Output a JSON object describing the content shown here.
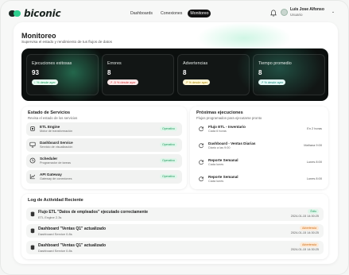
{
  "brand": {
    "name": "biconic"
  },
  "nav": {
    "items": [
      "Dashboards",
      "Conexiones",
      "Monitoreo"
    ],
    "active_index": 2
  },
  "user": {
    "name": "Luis Jose Alfonso",
    "role": "Usuario"
  },
  "page": {
    "title": "Monitoreo",
    "subtitle": "Supervisa el estado y rendimiento de tus flujos de datos"
  },
  "metrics": [
    {
      "label": "Ejecuciones exitosas",
      "value": "93",
      "delta": "↑ % desde ayer",
      "tone": "green"
    },
    {
      "label": "Errores",
      "value": "8",
      "delta": "↗ -5 % desde ayer",
      "tone": "red"
    },
    {
      "label": "Advertencias",
      "value": "8",
      "delta": "↗ % desde ayer",
      "tone": "yellow"
    },
    {
      "label": "Tiempo promedio",
      "value": "8",
      "delta": "↗ % desde ayer",
      "tone": "teal"
    }
  ],
  "services": {
    "title": "Estado de Servicios",
    "subtitle": "Revisa el estado de los servicios",
    "items": [
      {
        "name": "ETL Engine",
        "desc": "Motor de transformación",
        "status": "Operativo",
        "icon": "cpu-icon"
      },
      {
        "name": "Dashboard Service",
        "desc": "Servicio de visualización",
        "status": "Operativo",
        "icon": "monitor-icon"
      },
      {
        "name": "Scheduler",
        "desc": "Programador de tareas",
        "status": "Operativo",
        "icon": "clock-icon"
      },
      {
        "name": "API Gateway",
        "desc": "Gateway de conexiones",
        "status": "Operativo",
        "icon": "chart-icon"
      }
    ]
  },
  "schedule": {
    "title": "Próximas ejecuciones",
    "subtitle": "Flujos programados para ejecutarse pronto",
    "items": [
      {
        "name": "Flujo ETL - Inventario",
        "desc": "Cada 6 horas",
        "time": "En 2 horas",
        "icon": "refresh-icon"
      },
      {
        "name": "Dashboard - Ventas Diarias",
        "desc": "Diario a las 9:00",
        "time": "Mañana 9:00",
        "icon": "refresh-icon"
      },
      {
        "name": "Reporte Semanal",
        "desc": "Cada lunes",
        "time": "Lunes 8:00",
        "icon": "refresh-icon"
      },
      {
        "name": "Reporte Semanal",
        "desc": "Cada lunes",
        "time": "Lunes 8:00",
        "icon": "refresh-icon"
      }
    ]
  },
  "activity": {
    "title": "Log de Actividad Reciente",
    "items": [
      {
        "title": "Flujo ETL \"Datos de empleados\" ejecutado correctamente",
        "source": "ETL Engine 2.3s",
        "badge": "Éxito",
        "tone": "ok",
        "time": "2024-01-15 14:30:25"
      },
      {
        "title": "Dashboard \"Ventas Q1\" actualizado",
        "source": "Dashboard Service 0.8s",
        "badge": "Advertencia",
        "tone": "warn",
        "time": "2024-01-15 14:30:25"
      },
      {
        "title": "Dashboard \"Ventas Q1\" actualizado",
        "source": "Dashboard Service 0.8s",
        "badge": "Advertencia",
        "tone": "warn",
        "time": "2024-01-15 14:30:25"
      }
    ]
  },
  "colors": {
    "accent": "#2ecf8f",
    "dark": "#0b0f0e",
    "ok": "#1c9a5b",
    "warn": "#d06a10",
    "error": "#d33a3a"
  }
}
